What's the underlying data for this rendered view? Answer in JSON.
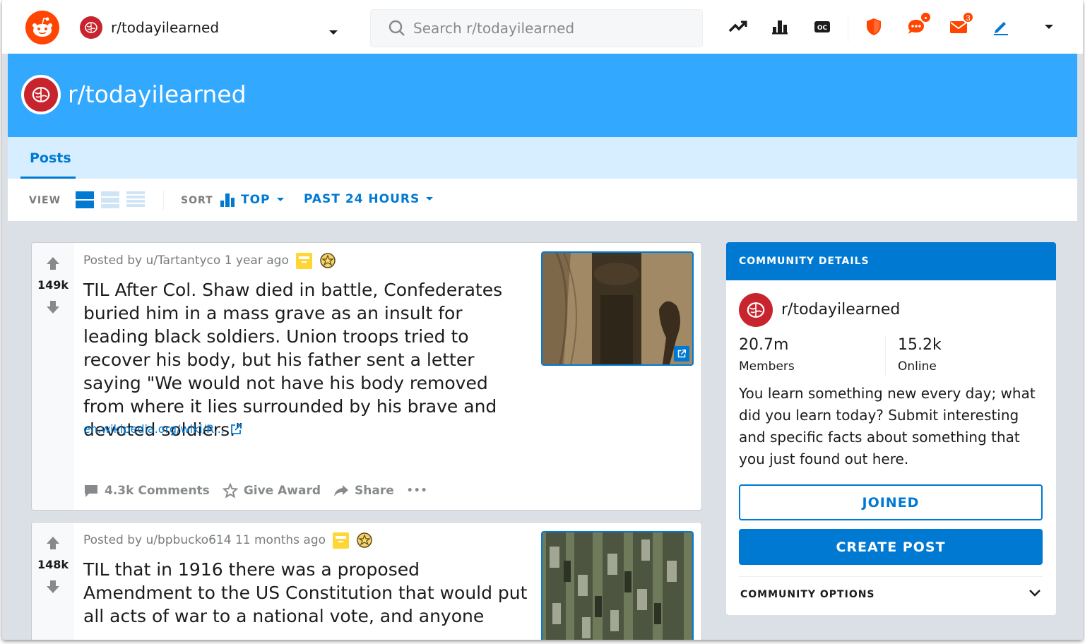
{
  "header": {
    "subreddit": "r/todayilearned",
    "search_placeholder": "Search r/todayilearned",
    "icons": [
      "popular-icon",
      "all-icon",
      "oc-icon",
      "mod-shield-icon",
      "chat-icon",
      "inbox-icon",
      "create-post-pencil-icon",
      "user-menu-caret-icon"
    ],
    "chat_badge": "•",
    "inbox_badge": "3",
    "colors": {
      "brand": "#ff4500",
      "accent": "#0079d3",
      "banner": "#33a8ff",
      "tabs_bg": "#d6eeff",
      "sub_icon": "#c8242e"
    }
  },
  "banner": {
    "title": "r/todayilearned"
  },
  "tabs": [
    {
      "label": "Posts",
      "active": true
    }
  ],
  "viewbar": {
    "view_label": "VIEW",
    "sort_label": "SORT",
    "sort_value": "TOP",
    "time_value": "PAST 24 HOURS"
  },
  "posts": [
    {
      "votes": "149k",
      "meta": "Posted by u/Tartantyco 1 year ago",
      "title": "TIL After Col. Shaw died in battle, Confederates buried him in a mass grave as an insult for leading black soldiers. Union troops tried to recover his body, but his father sent a letter saying \"We would not have his body removed from where it lies surrounded by his brave and devoted soldiers.\"",
      "link": "en.wikipedia.org/wiki/R...",
      "comments": "4.3k Comments",
      "award": "Give Award",
      "share": "Share",
      "more": "•••"
    },
    {
      "votes": "148k",
      "meta": "Posted by u/bpbucko614 11 months ago",
      "title": "TIL that in 1916 there was a proposed Amendment to the US Constitution that would put all acts of war to a national vote, and anyone"
    }
  ],
  "sidebar": {
    "heading": "COMMUNITY DETAILS",
    "name": "r/todayilearned",
    "members": "20.7m",
    "members_label": "Members",
    "online": "15.2k",
    "online_label": "Online",
    "description": "You learn something new every day; what did you learn today? Submit interesting and specific facts about something that you just found out here.",
    "joined_label": "JOINED",
    "create_label": "CREATE POST",
    "options_label": "COMMUNITY OPTIONS"
  }
}
